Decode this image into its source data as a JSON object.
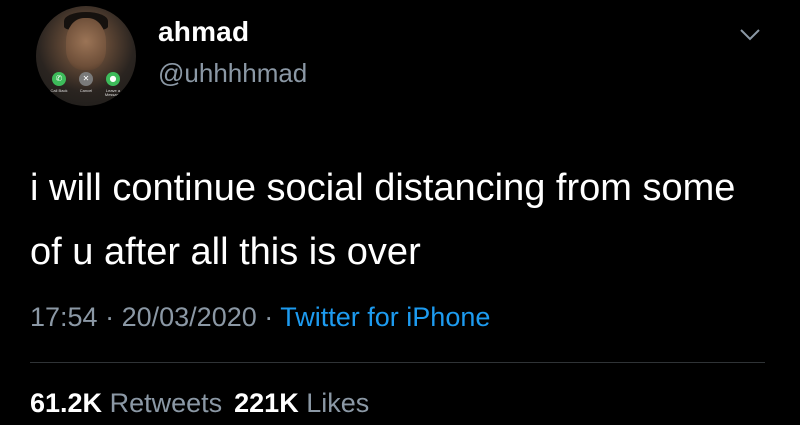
{
  "user": {
    "display_name": "ahmad",
    "handle": "@uhhhhmad"
  },
  "avatar": {
    "call_buttons": {
      "call_back": "Call Back",
      "cancel": "Cancel",
      "message": "Leave a Message"
    }
  },
  "tweet": {
    "text": "i will continue social distancing from some of u after all this is over",
    "time": "17:54",
    "separator": "·",
    "date": "20/03/2020",
    "source": "Twitter for iPhone"
  },
  "stats": {
    "retweets_count": "61.2K",
    "retweets_label": "Retweets",
    "likes_count": "221K",
    "likes_label": "Likes"
  },
  "colors": {
    "background": "#000000",
    "text_primary": "#ffffff",
    "text_secondary": "#8b98a5",
    "link": "#1d9bf0",
    "divider": "#2f3336"
  },
  "icons": {
    "menu": "chevron-down-icon"
  }
}
